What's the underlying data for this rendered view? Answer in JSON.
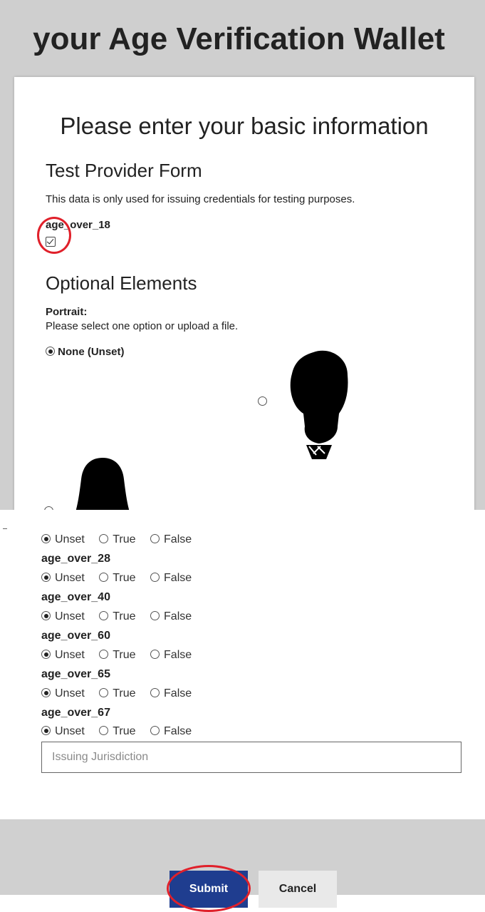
{
  "app": {
    "title": "your Age Verification Wallet"
  },
  "form": {
    "heading": "Please enter your basic information",
    "provider_title": "Test Provider Form",
    "provider_note": "This data is only used for issuing credentials for testing purposes.",
    "age_over_18_label": "age_over_18",
    "age_over_18_checked": true
  },
  "optional": {
    "title": "Optional Elements",
    "portrait_label": "Portrait:",
    "portrait_hint": "Please select one option or upload a file.",
    "portrait_options": [
      {
        "label": "None (Unset)",
        "selected": true
      },
      {
        "icon": "male-portrait-silhouette",
        "selected": false
      },
      {
        "icon": "female-portrait-silhouette",
        "selected": false
      }
    ]
  },
  "bool_options": [
    "Unset",
    "True",
    "False"
  ],
  "first_group_selected": "Unset",
  "age_fields": [
    {
      "label": "age_over_28",
      "selected": "Unset"
    },
    {
      "label": "age_over_40",
      "selected": "Unset"
    },
    {
      "label": "age_over_60",
      "selected": "Unset"
    },
    {
      "label": "age_over_65",
      "selected": "Unset"
    },
    {
      "label": "age_over_67",
      "selected": "Unset"
    }
  ],
  "jurisdiction": {
    "placeholder": "Issuing Jurisdiction",
    "value": ""
  },
  "actions": {
    "submit": "Submit",
    "cancel": "Cancel"
  },
  "colors": {
    "submit_bg": "#1f3d8f",
    "annotation": "#e0202a",
    "page_bg": "#cfcfcf"
  }
}
